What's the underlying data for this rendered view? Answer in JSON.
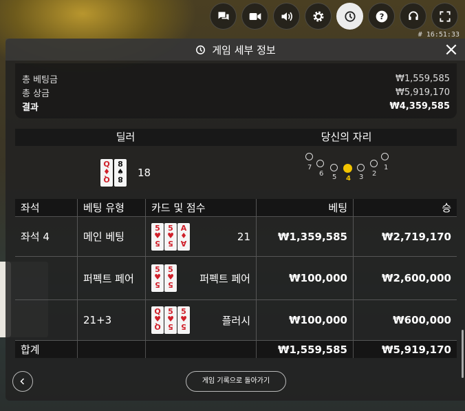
{
  "toolbar": {
    "buttons": [
      "chat-icon",
      "video-icon",
      "volume-icon",
      "gear-icon",
      "history-icon",
      "help-icon",
      "support-icon",
      "fullscreen-icon"
    ],
    "active": "history-icon",
    "clock": "# 16:51:33"
  },
  "panel": {
    "title": "게임 세부 정보"
  },
  "summary": {
    "total_bet_label": "총 베팅금",
    "total_bet_value": "₩1,559,585",
    "total_win_label": "총 상금",
    "total_win_value": "₩5,919,170",
    "result_label": "결과",
    "result_value": "₩4,359,585"
  },
  "positions": {
    "dealer_label": "딜러",
    "your_seat_label": "당신의 자리"
  },
  "dealer": {
    "cards": [
      {
        "rank": "Q",
        "suit": "♦",
        "color": "red"
      },
      {
        "rank": "8",
        "suit": "♠",
        "color": "black"
      }
    ],
    "score": "18"
  },
  "seats": {
    "numbers": [
      "7",
      "6",
      "5",
      "4",
      "3",
      "2",
      "1"
    ],
    "selected": "4",
    "highlight_color": "#f2c400"
  },
  "table": {
    "headers": [
      "좌석",
      "베팅 유형",
      "카드 및 점수",
      "베팅",
      "승"
    ],
    "rows": [
      {
        "seat": "좌석 4",
        "type": "메인 베팅",
        "cards": [
          {
            "rank": "5",
            "suit": "♥"
          },
          {
            "rank": "5",
            "suit": "♥"
          },
          {
            "rank": "A",
            "suit": "♦"
          }
        ],
        "score": "21",
        "bet": "₩1,359,585",
        "win": "₩2,719,170"
      },
      {
        "seat": "",
        "type": "퍼펙트 페어",
        "cards": [
          {
            "rank": "5",
            "suit": "♥"
          },
          {
            "rank": "5",
            "suit": "♥"
          }
        ],
        "score": "퍼펙트 페어",
        "bet": "₩100,000",
        "win": "₩2,600,000"
      },
      {
        "seat": "",
        "type": "21+3",
        "cards": [
          {
            "rank": "Q",
            "suit": "♥"
          },
          {
            "rank": "5",
            "suit": "♥"
          },
          {
            "rank": "5",
            "suit": "♥"
          }
        ],
        "score": "플러시",
        "bet": "₩100,000",
        "win": "₩600,000"
      }
    ],
    "total": {
      "label": "합계",
      "bet": "₩1,559,585",
      "win": "₩5,919,170"
    }
  },
  "footer": {
    "back_history_label": "게임 기록으로 돌아가기"
  }
}
